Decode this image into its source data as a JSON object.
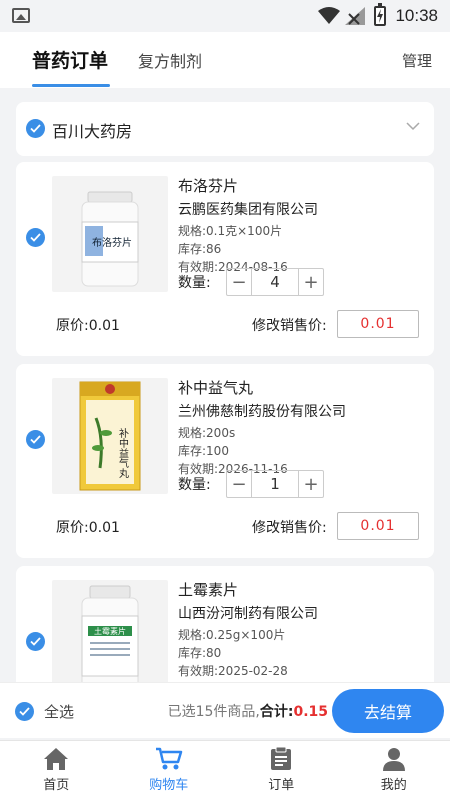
{
  "status_bar": {
    "time": "10:38"
  },
  "top_tabs": {
    "active": "普药订单",
    "other": "复方制剂",
    "manage": "管理"
  },
  "pharmacy": {
    "name": "百川大药房"
  },
  "products": [
    {
      "name": "布洛芬片",
      "maker": "云鹏医药集团有限公司",
      "spec": "规格:0.1克×100片",
      "stock": "库存:86",
      "expiry": "有效期:2024-08-16",
      "qty_label": "数量:",
      "qty": "4",
      "orig_price": "原价:0.01",
      "mod_label": "修改销售价:",
      "mod_price": "0.01",
      "image_label": "布洛芬片"
    },
    {
      "name": "补中益气丸",
      "maker": "兰州佛慈制药股份有限公司",
      "spec": "规格:200s",
      "stock": "库存:100",
      "expiry": "有效期:2026-11-16",
      "qty_label": "数量:",
      "qty": "1",
      "orig_price": "原价:0.01",
      "mod_label": "修改销售价:",
      "mod_price": "0.01",
      "image_label": "补中益气丸"
    },
    {
      "name": "土霉素片",
      "maker": "山西汾河制药有限公司",
      "spec": "规格:0.25g×100片",
      "stock": "库存:80",
      "expiry": "有效期:2025-02-28",
      "image_label": "土霉素片"
    }
  ],
  "bottom": {
    "select_all": "全选",
    "selected_text": "已选15件商品,",
    "total_label": "合计:",
    "total": "0.15",
    "checkout": "去结算"
  },
  "nav": [
    {
      "label": "首页",
      "icon": "home-icon"
    },
    {
      "label": "购物车",
      "icon": "cart-icon"
    },
    {
      "label": "订单",
      "icon": "order-icon"
    },
    {
      "label": "我的",
      "icon": "person-icon"
    }
  ],
  "colors": {
    "accent": "#2f86f0",
    "price_red": "#e53030"
  }
}
